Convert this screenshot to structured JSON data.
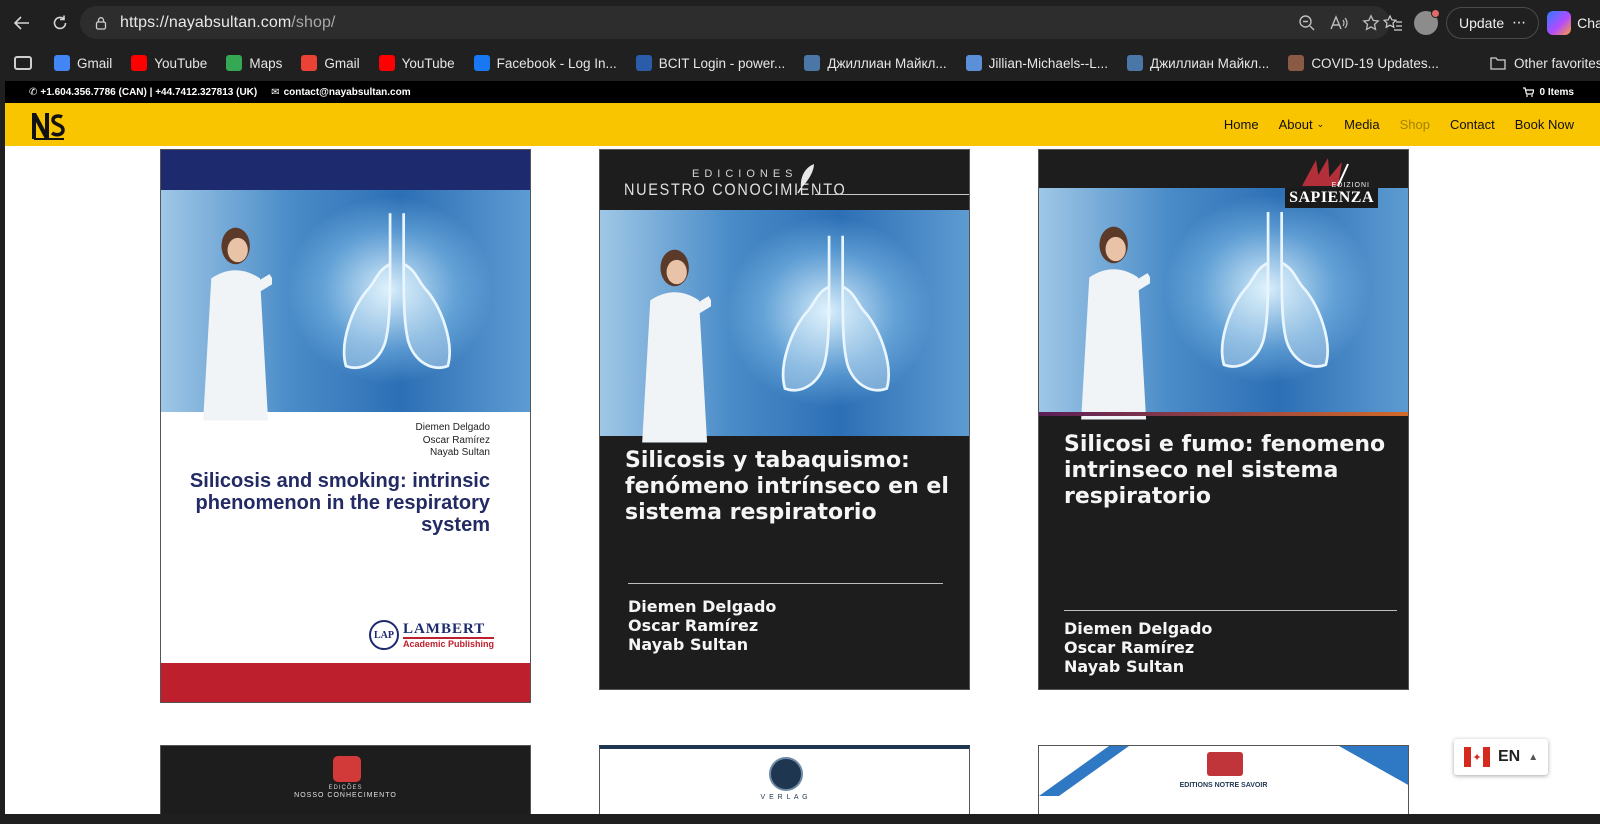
{
  "browser": {
    "url_host": "https://nayabsultan.com",
    "url_path": "/shop/",
    "update_label": "Update",
    "copilot_label": "Chat",
    "bookmarks": [
      {
        "label": "Gmail",
        "icon": "google-icon",
        "color": "#4285f4"
      },
      {
        "label": "YouTube",
        "icon": "youtube-icon",
        "color": "#ff0000"
      },
      {
        "label": "Maps",
        "icon": "maps-icon",
        "color": "#34a853"
      },
      {
        "label": "Gmail",
        "icon": "gmail-icon",
        "color": "#ea4335"
      },
      {
        "label": "YouTube",
        "icon": "youtube-icon",
        "color": "#ff0000"
      },
      {
        "label": "Facebook - Log In...",
        "icon": "facebook-icon",
        "color": "#1877f2"
      },
      {
        "label": "BCIT Login - power...",
        "icon": "bcit-icon",
        "color": "#2a5caa"
      },
      {
        "label": "Джиллиан Майкл...",
        "icon": "vk-icon",
        "color": "#4a76a8"
      },
      {
        "label": "Jillian-Michaels--L...",
        "icon": "video-icon",
        "color": "#5b8fd8"
      },
      {
        "label": "Джиллиан Майкл...",
        "icon": "vk-icon",
        "color": "#4a76a8"
      },
      {
        "label": "COVID-19 Updates...",
        "icon": "covid-icon",
        "color": "#8a5a44"
      }
    ],
    "other_favorites": "Other favorites"
  },
  "site": {
    "phone": "+1.604.356.7786 (CAN) | +44.7412.327813 (UK)",
    "email": "contact@nayabsultan.com",
    "cart": "0 Items",
    "nav": [
      "Home",
      "About",
      "Media",
      "Shop",
      "Contact",
      "Book Now"
    ],
    "active_nav": "Shop",
    "accent_color": "#f9c400"
  },
  "products": [
    {
      "authors": [
        "Diemen Delgado",
        "Oscar Ramírez",
        "Nayab Sultan"
      ],
      "title": "Silicosis and smoking: intrinsic phenomenon in the respiratory system",
      "publisher_line1": "LAMBERT",
      "publisher_line2": "Academic Publishing",
      "publisher_mark": "LAP"
    },
    {
      "publisher_small": "EDICIONES",
      "publisher_big": "NUESTRO CONOCIMIENTO",
      "title": "Silicosis y tabaquismo: fenómeno intrínseco en el sistema respiratorio",
      "authors": [
        "Diemen Delgado",
        "Oscar Ramírez",
        "Nayab Sultan"
      ]
    },
    {
      "publisher_small": "EDIZIONI",
      "publisher_big": "SAPIENZA",
      "title": "Silicosi e fumo: fenomeno intrinseco nel sistema respiratorio",
      "authors": [
        "Diemen Delgado",
        "Oscar Ramírez",
        "Nayab Sultan"
      ]
    }
  ],
  "row2": [
    {
      "label_small": "EDIÇÕES",
      "label": "NOSSO CONHECIMENTO"
    },
    {
      "label": "V E R L A G"
    },
    {
      "label": "EDITIONS NOTRE SAVOIR"
    }
  ],
  "language": {
    "code": "EN"
  }
}
